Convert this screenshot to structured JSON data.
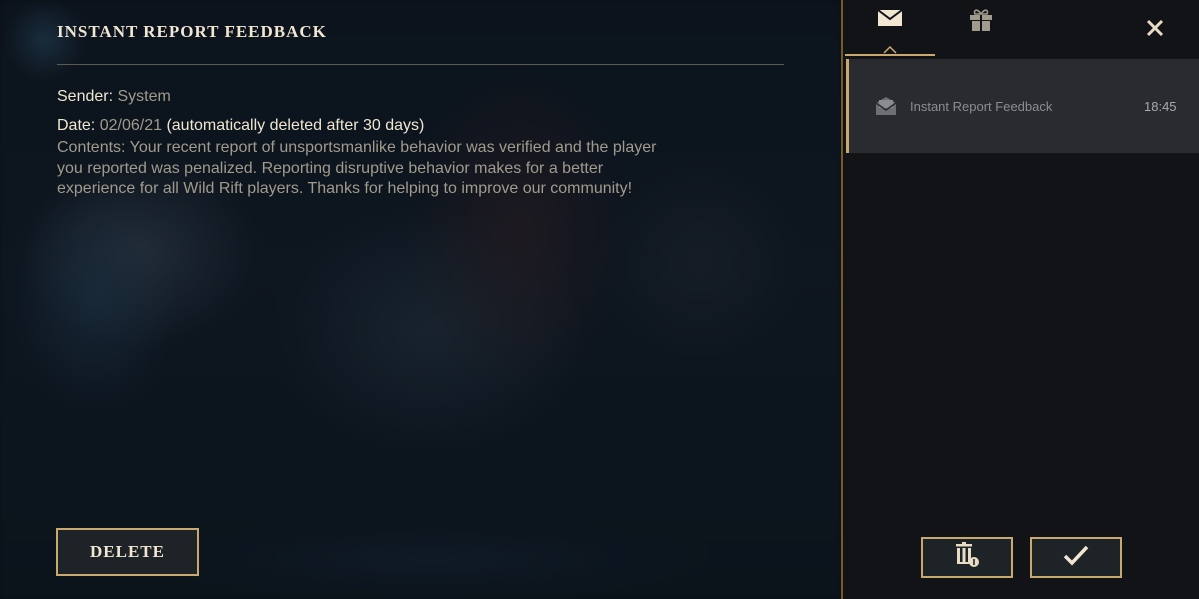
{
  "message": {
    "title": "INSTANT REPORT FEEDBACK",
    "sender_label": "Sender:",
    "sender_value": "System",
    "date_label": "Date:",
    "date_value": "02/06/21",
    "date_note": "(automatically deleted after 30 days)",
    "contents": "Contents: Your recent report of unsportsmanlike behavior was verified and the player you reported was penalized. Reporting disruptive behavior makes for a better experience for all Wild Rift players. Thanks for helping to improve our community!",
    "delete_label": "DELETE"
  },
  "panel": {
    "tabs": [
      {
        "icon": "envelope-icon",
        "active": true
      },
      {
        "icon": "gift-icon",
        "active": false
      }
    ],
    "close_icon": "close-icon",
    "mail_items": [
      {
        "icon": "envelope-open-icon",
        "label": "Instant Report Feedback",
        "time": "18:45",
        "selected": true
      }
    ],
    "buttons": {
      "delete_read_icon": "trash-icon",
      "confirm_icon": "checkmark-icon"
    }
  },
  "colors": {
    "gold": "#c8aa6e",
    "gold_dark": "#785a28",
    "text_light": "#f0e6d2",
    "text_muted": "#a09b8c",
    "panel_bg": "#111317",
    "selected_bg": "#2a2b2f",
    "button_bg": "#1e2328"
  }
}
